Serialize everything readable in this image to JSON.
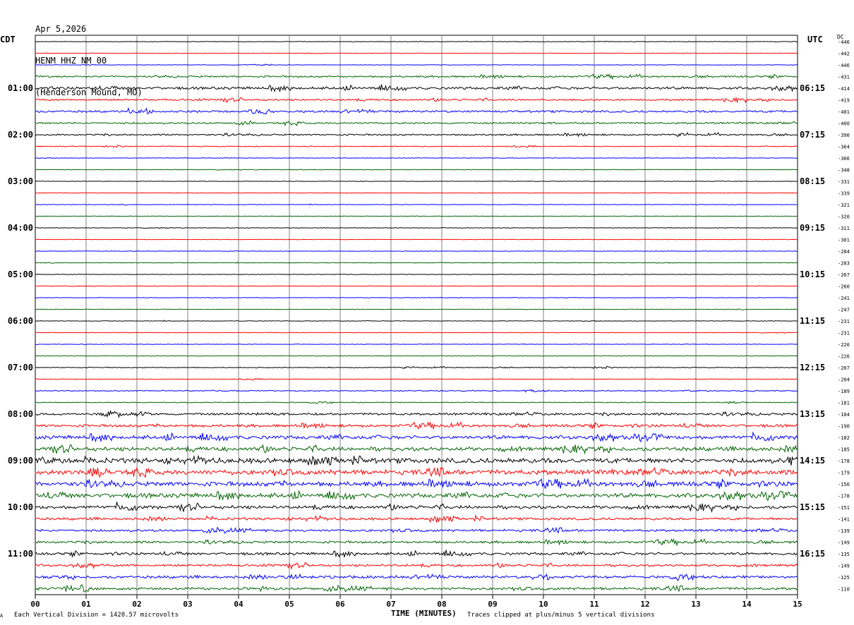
{
  "header": {
    "date": "Apr 5,2026",
    "channel": "HENM HHZ NM 00",
    "location": "(Henderson Mound, MO)"
  },
  "left_tz_label": "CDT",
  "right_tz_label": "UTC",
  "dc_label": "DC",
  "footer": {
    "scale_note": "Each Vertical Division = 1428.57 microvolts",
    "clip_note": "Traces clipped at plus/minus 5 vertical divisions",
    "corner_mark": "A"
  },
  "colors": {
    "black": "#000000",
    "red": "#ff0000",
    "blue": "#0000ff",
    "green": "#006400",
    "grid": "#808080"
  },
  "chart_data": {
    "type": "line",
    "title": "HENM HHZ NM 00",
    "xlabel": "TIME (MINUTES)",
    "xlim": [
      0,
      15
    ],
    "x_ticks": [
      "00",
      "01",
      "02",
      "03",
      "04",
      "05",
      "06",
      "07",
      "08",
      "09",
      "10",
      "11",
      "12",
      "13",
      "14",
      "15"
    ],
    "trace_color_cycle": [
      "black",
      "red",
      "blue",
      "green"
    ],
    "left_hour_labels": [
      "01:00",
      "02:00",
      "03:00",
      "04:00",
      "05:00",
      "06:00",
      "07:00",
      "08:00",
      "09:00",
      "10:00",
      "11:00"
    ],
    "right_hour_labels": [
      "06:15",
      "07:15",
      "08:15",
      "09:15",
      "10:15",
      "11:15",
      "12:15",
      "13:15",
      "14:15",
      "15:15",
      "16:15"
    ],
    "dc_offsets": [
      "-446",
      "-442",
      "-446",
      "-431",
      "-414",
      "-419",
      "-401",
      "-400",
      "-390",
      "-364",
      "-366",
      "-348",
      "-331",
      "-339",
      "-321",
      "-320",
      "-311",
      "-301",
      "-284",
      "-283",
      "-267",
      "-260",
      "-241",
      "-247",
      "-231",
      "-231",
      "-220",
      "-226",
      "-207",
      "-204",
      "-189",
      "-181",
      "-184",
      "-190",
      "-182",
      "-185",
      "-178",
      "-179",
      "-150",
      "-178",
      "-151",
      "-141",
      "-139",
      "-149",
      "-135",
      "-149",
      "-125",
      "-110"
    ],
    "trace_noise_level": [
      0.3,
      0.3,
      0.3,
      1.0,
      1.4,
      1.0,
      1.2,
      1.0,
      0.9,
      0.5,
      0.3,
      0.3,
      0.3,
      0.3,
      0.3,
      0.3,
      0.3,
      0.3,
      0.3,
      0.3,
      0.3,
      0.3,
      0.3,
      0.3,
      0.3,
      0.3,
      0.3,
      0.3,
      0.5,
      0.4,
      0.6,
      0.5,
      1.3,
      1.5,
      2.0,
      2.2,
      2.8,
      2.8,
      2.6,
      2.4,
      1.8,
      1.4,
      1.4,
      1.3,
      1.4,
      1.3,
      1.5,
      1.5
    ]
  }
}
